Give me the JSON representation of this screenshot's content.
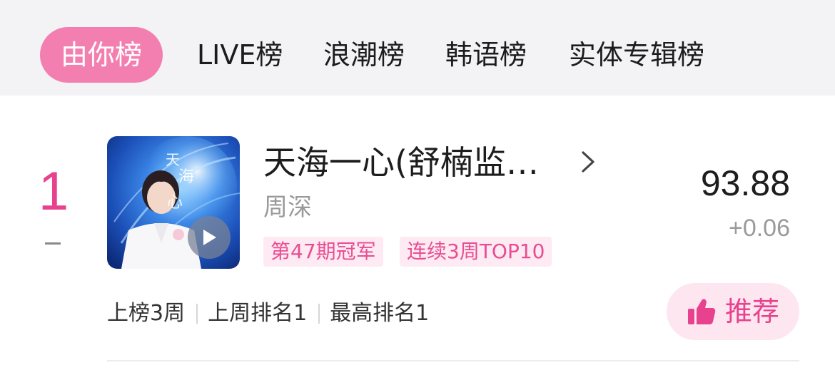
{
  "tabs": [
    {
      "label": "由你榜",
      "active": true
    },
    {
      "label": "LIVE榜",
      "active": false
    },
    {
      "label": "浪潮榜",
      "active": false
    },
    {
      "label": "韩语榜",
      "active": false
    },
    {
      "label": "实体专辑榜",
      "active": false
    }
  ],
  "entry": {
    "rank": "1",
    "rank_change": "–",
    "title": "天海一心(舒楠监…",
    "artist": "周深",
    "badges": [
      "第47期冠军",
      "连续3周TOP10"
    ],
    "score": "93.88",
    "score_delta": "+0.06",
    "stats": [
      "上榜3周",
      "上周排名1",
      "最高排名1"
    ],
    "recommend_label": "推荐",
    "cover_text": "天海一心"
  },
  "colors": {
    "accent": "#e8418d",
    "tab_active_bg": "#f37fb0",
    "badge_bg": "#fdeaf2",
    "recommend_bg": "#fde6f0"
  },
  "icons": {
    "chevron": "chevron-right-icon",
    "play": "play-icon",
    "thumbs_up": "thumbs-up-icon"
  }
}
